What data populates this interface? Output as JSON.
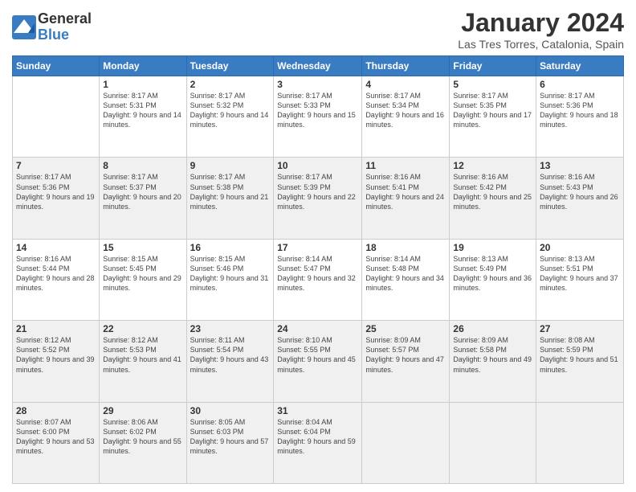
{
  "logo": {
    "general": "General",
    "blue": "Blue"
  },
  "title": "January 2024",
  "subtitle": "Las Tres Torres, Catalonia, Spain",
  "headers": [
    "Sunday",
    "Monday",
    "Tuesday",
    "Wednesday",
    "Thursday",
    "Friday",
    "Saturday"
  ],
  "weeks": [
    [
      {
        "day": "",
        "info": ""
      },
      {
        "day": "1",
        "info": "Sunrise: 8:17 AM\nSunset: 5:31 PM\nDaylight: 9 hours\nand 14 minutes."
      },
      {
        "day": "2",
        "info": "Sunrise: 8:17 AM\nSunset: 5:32 PM\nDaylight: 9 hours\nand 14 minutes."
      },
      {
        "day": "3",
        "info": "Sunrise: 8:17 AM\nSunset: 5:33 PM\nDaylight: 9 hours\nand 15 minutes."
      },
      {
        "day": "4",
        "info": "Sunrise: 8:17 AM\nSunset: 5:34 PM\nDaylight: 9 hours\nand 16 minutes."
      },
      {
        "day": "5",
        "info": "Sunrise: 8:17 AM\nSunset: 5:35 PM\nDaylight: 9 hours\nand 17 minutes."
      },
      {
        "day": "6",
        "info": "Sunrise: 8:17 AM\nSunset: 5:36 PM\nDaylight: 9 hours\nand 18 minutes."
      }
    ],
    [
      {
        "day": "7",
        "info": "Sunrise: 8:17 AM\nSunset: 5:36 PM\nDaylight: 9 hours\nand 19 minutes."
      },
      {
        "day": "8",
        "info": "Sunrise: 8:17 AM\nSunset: 5:37 PM\nDaylight: 9 hours\nand 20 minutes."
      },
      {
        "day": "9",
        "info": "Sunrise: 8:17 AM\nSunset: 5:38 PM\nDaylight: 9 hours\nand 21 minutes."
      },
      {
        "day": "10",
        "info": "Sunrise: 8:17 AM\nSunset: 5:39 PM\nDaylight: 9 hours\nand 22 minutes."
      },
      {
        "day": "11",
        "info": "Sunrise: 8:16 AM\nSunset: 5:41 PM\nDaylight: 9 hours\nand 24 minutes."
      },
      {
        "day": "12",
        "info": "Sunrise: 8:16 AM\nSunset: 5:42 PM\nDaylight: 9 hours\nand 25 minutes."
      },
      {
        "day": "13",
        "info": "Sunrise: 8:16 AM\nSunset: 5:43 PM\nDaylight: 9 hours\nand 26 minutes."
      }
    ],
    [
      {
        "day": "14",
        "info": "Sunrise: 8:16 AM\nSunset: 5:44 PM\nDaylight: 9 hours\nand 28 minutes."
      },
      {
        "day": "15",
        "info": "Sunrise: 8:15 AM\nSunset: 5:45 PM\nDaylight: 9 hours\nand 29 minutes."
      },
      {
        "day": "16",
        "info": "Sunrise: 8:15 AM\nSunset: 5:46 PM\nDaylight: 9 hours\nand 31 minutes."
      },
      {
        "day": "17",
        "info": "Sunrise: 8:14 AM\nSunset: 5:47 PM\nDaylight: 9 hours\nand 32 minutes."
      },
      {
        "day": "18",
        "info": "Sunrise: 8:14 AM\nSunset: 5:48 PM\nDaylight: 9 hours\nand 34 minutes."
      },
      {
        "day": "19",
        "info": "Sunrise: 8:13 AM\nSunset: 5:49 PM\nDaylight: 9 hours\nand 36 minutes."
      },
      {
        "day": "20",
        "info": "Sunrise: 8:13 AM\nSunset: 5:51 PM\nDaylight: 9 hours\nand 37 minutes."
      }
    ],
    [
      {
        "day": "21",
        "info": "Sunrise: 8:12 AM\nSunset: 5:52 PM\nDaylight: 9 hours\nand 39 minutes."
      },
      {
        "day": "22",
        "info": "Sunrise: 8:12 AM\nSunset: 5:53 PM\nDaylight: 9 hours\nand 41 minutes."
      },
      {
        "day": "23",
        "info": "Sunrise: 8:11 AM\nSunset: 5:54 PM\nDaylight: 9 hours\nand 43 minutes."
      },
      {
        "day": "24",
        "info": "Sunrise: 8:10 AM\nSunset: 5:55 PM\nDaylight: 9 hours\nand 45 minutes."
      },
      {
        "day": "25",
        "info": "Sunrise: 8:09 AM\nSunset: 5:57 PM\nDaylight: 9 hours\nand 47 minutes."
      },
      {
        "day": "26",
        "info": "Sunrise: 8:09 AM\nSunset: 5:58 PM\nDaylight: 9 hours\nand 49 minutes."
      },
      {
        "day": "27",
        "info": "Sunrise: 8:08 AM\nSunset: 5:59 PM\nDaylight: 9 hours\nand 51 minutes."
      }
    ],
    [
      {
        "day": "28",
        "info": "Sunrise: 8:07 AM\nSunset: 6:00 PM\nDaylight: 9 hours\nand 53 minutes."
      },
      {
        "day": "29",
        "info": "Sunrise: 8:06 AM\nSunset: 6:02 PM\nDaylight: 9 hours\nand 55 minutes."
      },
      {
        "day": "30",
        "info": "Sunrise: 8:05 AM\nSunset: 6:03 PM\nDaylight: 9 hours\nand 57 minutes."
      },
      {
        "day": "31",
        "info": "Sunrise: 8:04 AM\nSunset: 6:04 PM\nDaylight: 9 hours\nand 59 minutes."
      },
      {
        "day": "",
        "info": ""
      },
      {
        "day": "",
        "info": ""
      },
      {
        "day": "",
        "info": ""
      }
    ]
  ]
}
